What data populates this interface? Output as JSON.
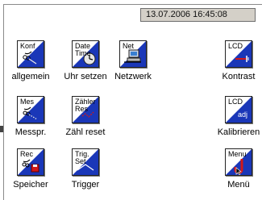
{
  "statusbar": {
    "datetime": "13.07.2006 16:45:08"
  },
  "tiles": [
    {
      "title": "Konf",
      "label": "allgemein"
    },
    {
      "title": "Date\nTime",
      "label": "Uhr setzen"
    },
    {
      "title": "Net",
      "label": "Netzwerk"
    },
    {
      "title": "LCD",
      "label": "Kontrast"
    },
    {
      "title": "Mes",
      "label": "Messpr."
    },
    {
      "title": "Zähler\nRes",
      "label": "Zähl reset"
    },
    {
      "title": "LCD",
      "label": "Kalibrieren",
      "sub": "adj"
    },
    {
      "title": "Rec",
      "label": "Speicher"
    },
    {
      "title": "Trig.\nSet",
      "label": "Trigger"
    },
    {
      "title": "Menu",
      "label": "Menü"
    }
  ],
  "colors": {
    "accent_blue": "#1a37b8",
    "accent_red": "#d21818",
    "bar": "#d4d0c8"
  }
}
